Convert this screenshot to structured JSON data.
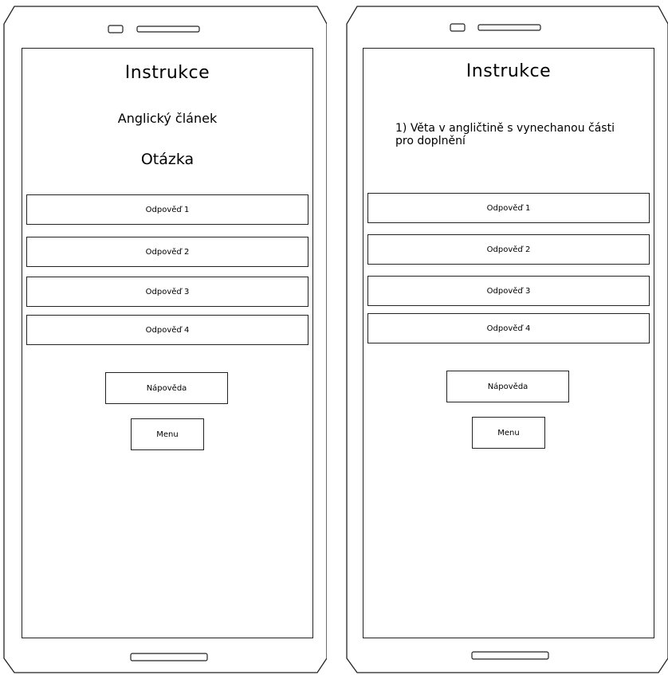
{
  "screens": [
    {
      "title": "Instrukce",
      "article": "Anglický článek",
      "question": "Otázka",
      "answers": [
        "Odpověď 1",
        "Odpověď 2",
        "Odpověď 3",
        "Odpověď 4"
      ],
      "hint_label": "Nápověda",
      "menu_label": "Menu"
    },
    {
      "title": "Instrukce",
      "sentence": "1) Věta v angličtině s vynechanou části pro doplnění",
      "answers": [
        "Odpověď 1",
        "Odpověď 2",
        "Odpověď 3",
        "Odpověď 4"
      ],
      "hint_label": "Nápověda",
      "menu_label": "Menu"
    }
  ]
}
